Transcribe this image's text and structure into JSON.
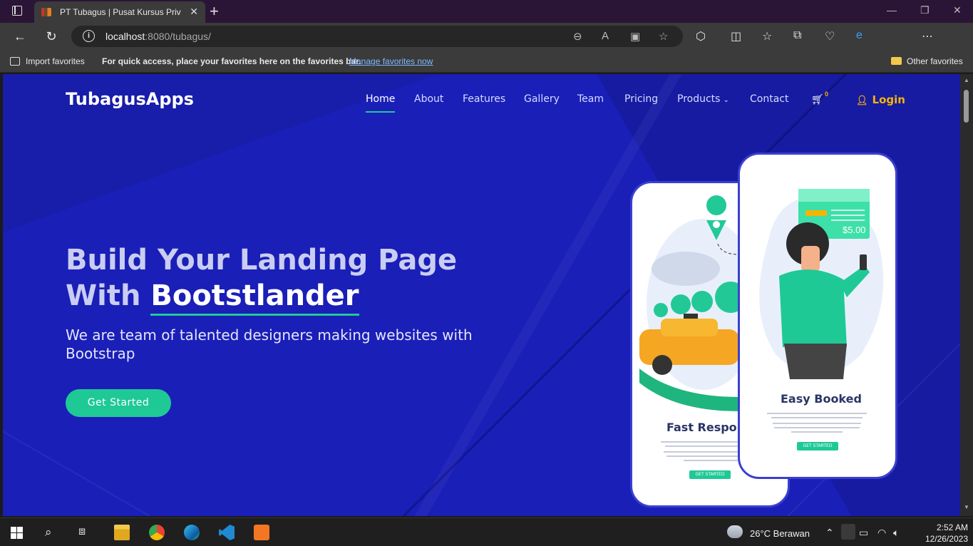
{
  "browser": {
    "tab_title": "PT Tubagus | Pusat Kursus Privat",
    "tab_close": "✕",
    "new_tab": "+",
    "url_host": "localhost",
    "url_rest": ":8080/tubagus/",
    "favorites_bar": {
      "import": "Import favorites",
      "tip": "For quick access, place your favorites here on the favorites bar.",
      "manage_link": "Manage favorites now",
      "other": "Other favorites"
    }
  },
  "site": {
    "logo": "TubagusApps",
    "nav": {
      "home": "Home",
      "about": "About",
      "features": "Features",
      "gallery": "Gallery",
      "team": "Team",
      "pricing": "Pricing",
      "products": "Products",
      "contact": "Contact",
      "login": "Login",
      "cart_count": "0"
    },
    "hero": {
      "title_part1": "Build Your Landing Page",
      "title_part2": "With ",
      "title_strong": "Bootstlander",
      "subtitle": "We are team of talented designers making websites with Bootstrap",
      "cta": "Get Started"
    },
    "phone_left": {
      "caption": "Fast Respon",
      "button": "GET STARTED"
    },
    "phone_right": {
      "caption": "Easy Booked",
      "price": "$5.00",
      "button": "GET STARTED"
    }
  },
  "taskbar": {
    "weather": "26°C  Berawan",
    "time": "2:52 AM",
    "date": "12/26/2023"
  },
  "colors": {
    "page_bg": "#1a1fb8",
    "accent_green": "#1fc996",
    "login_yellow": "#f5b400",
    "titlebar": "#2b1536"
  }
}
